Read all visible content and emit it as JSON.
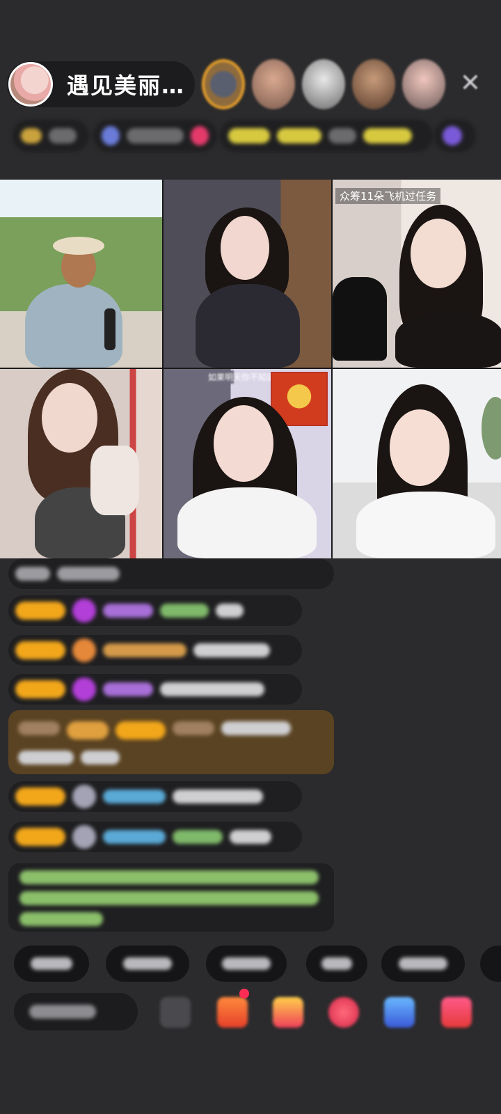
{
  "header": {
    "host_name": "遇见美丽…",
    "close_icon": "close-icon"
  },
  "grid": {
    "caption_top_right": "众筹11朵飞机过任务",
    "caption_middle": "如果明天你不知道"
  },
  "colors": {
    "background": "#2b2b2d",
    "level_badge": "#f2a71b",
    "pill": "#1f1f21",
    "highlight_bar": "#5a4322"
  }
}
